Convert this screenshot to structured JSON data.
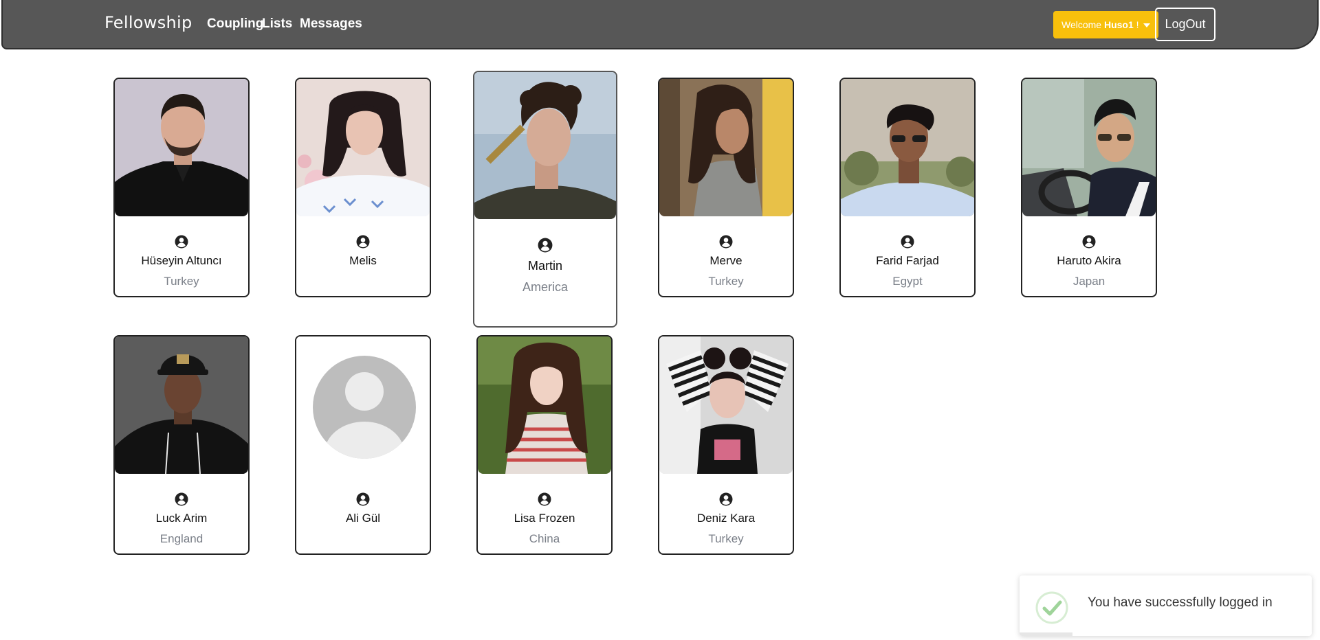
{
  "navbar": {
    "brand": "Fellowship",
    "links": [
      {
        "label": "Coupling"
      },
      {
        "label": "Lists"
      },
      {
        "label": "Messages"
      }
    ],
    "welcome_prefix": "Welcome ",
    "username": "Huso1",
    "welcome_suffix": " !",
    "logout_label": "LogOut"
  },
  "profiles": [
    {
      "name": "Hüseyin Altuncı",
      "country": "Turkey",
      "photo": "man-dark-jacket"
    },
    {
      "name": "Melis",
      "country": "",
      "photo": "woman-dark-hair"
    },
    {
      "name": "Martin",
      "country": "America",
      "photo": "man-curly-hair"
    },
    {
      "name": "Merve",
      "country": "Turkey",
      "photo": "woman-curly-hair"
    },
    {
      "name": "Farid Farjad",
      "country": "Egypt",
      "photo": "man-sunglasses"
    },
    {
      "name": "Haruto Akira",
      "country": "Japan",
      "photo": "man-driving"
    },
    {
      "name": "Luck Arim",
      "country": "England",
      "photo": "man-cap-hoodie"
    },
    {
      "name": "Ali Gül",
      "country": "",
      "photo": "default-avatar"
    },
    {
      "name": "Lisa Frozen",
      "country": "China",
      "photo": "woman-striped-top"
    },
    {
      "name": "Deniz Kara",
      "country": "Turkey",
      "photo": "woman-striped-sleeves"
    }
  ],
  "toast": {
    "message": "You have successfully logged in",
    "icon": "check-circle-icon",
    "progress": 0.18
  },
  "colors": {
    "navbar": "#575757",
    "welcome_button": "#f8c00c",
    "country_text": "#7a7f88",
    "toast_check": "#9fd49a"
  }
}
